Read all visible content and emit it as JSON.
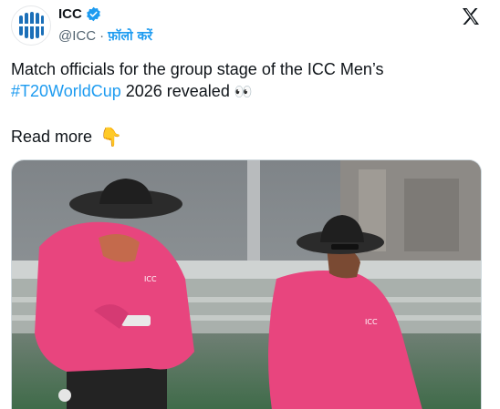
{
  "account": {
    "display_name": "ICC",
    "handle": "@ICC",
    "separator": "·",
    "follow_label": "फ़ॉलो करें",
    "avatar_icon": "icc-cricket-logo-icon",
    "verified_icon": "verified-badge-icon",
    "verified_color": "#1d9bf0"
  },
  "platform": {
    "logo_icon": "x-logo-icon"
  },
  "tweet": {
    "text_before": "Match officials for the group stage of the ICC Men’s",
    "hashtag": "#T20WorldCup",
    "text_after": " 2026 revealed ",
    "eyes_emoji": "👀",
    "read_more": "Read more",
    "pointer_emoji": "👇"
  },
  "media": {
    "description_icon": "photo-umpires-image",
    "shirt_logo_text": "ICC"
  },
  "colors": {
    "link": "#1d9bf0",
    "text": "#0f1419",
    "muted": "#536471",
    "umpire_shirt": "#e8457e"
  }
}
